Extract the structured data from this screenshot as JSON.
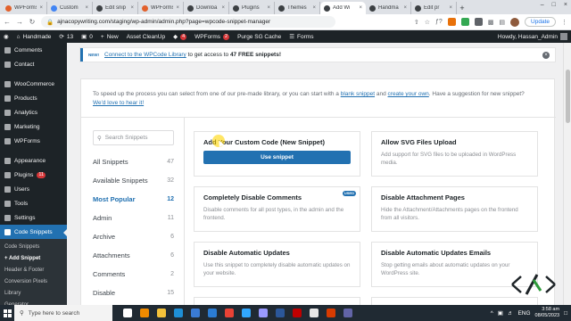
{
  "browser": {
    "tabs": [
      {
        "label": "WPForms",
        "color": "#e2612c"
      },
      {
        "label": "Custom",
        "color": "#4285f4"
      },
      {
        "label": "Edit snip",
        "color": "#3c4043"
      },
      {
        "label": "WPForms",
        "color": "#e2612c"
      },
      {
        "label": "Downloa",
        "color": "#3c4043"
      },
      {
        "label": "Plugins",
        "color": "#3c4043"
      },
      {
        "label": "Themes",
        "color": "#3c4043"
      },
      {
        "label": "Add Wi",
        "color": "#3c4043",
        "active": true
      },
      {
        "label": "Handma",
        "color": "#3c4043"
      },
      {
        "label": "Edit pr",
        "color": "#3c4043"
      }
    ],
    "url": "ajnacopywriting.com/staging/wp-admin/admin.php?page=wpcode-snippet-manager",
    "update_label": "Update"
  },
  "adminbar": {
    "site_name": "Handmade",
    "comments_count": "13",
    "updates_count": "0",
    "new_label": "New",
    "asset_cleanup": "Asset CleanUp",
    "yoast_badge": "4",
    "wpforms_label": "WPForms",
    "wpforms_badge": "2",
    "purge_label": "Purge SG Cache",
    "forms_label": "Forms",
    "howdy": "Howdy, Hassan_Admin"
  },
  "sidebar": {
    "items_top": [
      {
        "label": "Comments"
      },
      {
        "label": "Contact"
      }
    ],
    "items_mid": [
      {
        "label": "WooCommerce"
      },
      {
        "label": "Products"
      },
      {
        "label": "Analytics"
      },
      {
        "label": "Marketing"
      },
      {
        "label": "WPForms"
      }
    ],
    "items_bottom": [
      {
        "label": "Appearance"
      },
      {
        "label": "Plugins",
        "badge": "11"
      },
      {
        "label": "Users"
      },
      {
        "label": "Tools"
      },
      {
        "label": "Settings"
      }
    ],
    "current": "Code Snippets",
    "submenu": [
      "Code Snippets",
      "+ Add Snippet",
      "Header & Footer",
      "Conversion Pixels",
      "Library",
      "Generator"
    ]
  },
  "notice": {
    "tag": "NEW!",
    "link_text": "Connect to the WPCode Library",
    "text": "to get access to",
    "bold": "47 FREE snippets!"
  },
  "intro": {
    "text1": "To speed up the process you can select from one of our pre-made library, or you can start with a",
    "link1": "blank snippet",
    "and": "and",
    "link2": "create your own",
    "text2": ". Have a suggestion for new snippet?",
    "link3": "We'd love to hear it!"
  },
  "search_placeholder": "Search Snippets",
  "categories": [
    {
      "label": "All Snippets",
      "count": "47"
    },
    {
      "label": "Available Snippets",
      "count": "32"
    },
    {
      "label": "Most Popular",
      "count": "12",
      "active": true
    },
    {
      "label": "Admin",
      "count": "11"
    },
    {
      "label": "Archive",
      "count": "6"
    },
    {
      "label": "Attachments",
      "count": "6"
    },
    {
      "label": "Comments",
      "count": "2"
    },
    {
      "label": "Disable",
      "count": "15"
    }
  ],
  "cards": {
    "custom": {
      "title": "Add Your Custom Code (New Snippet)",
      "button": "Use snippet"
    },
    "svg": {
      "title": "Allow SVG Files Upload",
      "desc": "Add support for SVG files to be uploaded in WordPress media."
    },
    "comments": {
      "title": "Completely Disable Comments",
      "tag": "USED",
      "desc": "Disable comments for all post types, in the admin and the frontend."
    },
    "attachment": {
      "title": "Disable Attachment Pages",
      "desc": "Hide the Attachment/Attachments pages on the frontend from all visitors."
    },
    "auto_updates": {
      "title": "Disable Automatic Updates",
      "desc": "Use this snippet to completely disable automatic updates on your website."
    },
    "update_emails": {
      "title": "Disable Automatic Updates Emails",
      "desc": "Stop getting emails about automatic updates on your WordPress site."
    }
  },
  "taskbar": {
    "search_placeholder": "Type here to search",
    "time": "3:58 am",
    "date": "08/05/2023",
    "lang": "ENG"
  }
}
